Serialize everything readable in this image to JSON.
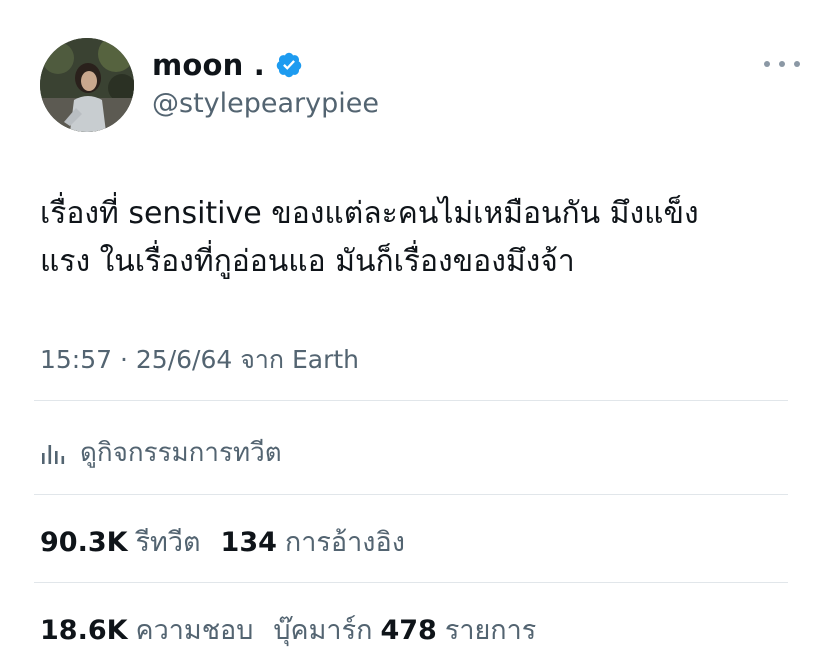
{
  "user": {
    "display_name": "moon .",
    "handle": "@stylepearypiee",
    "verified": true
  },
  "tweet": {
    "line1": "เรื่องที่ sensitive ของแต่ละคนไม่เหมือนกัน มึงแข็ง",
    "line2": "แรง ในเรื่องที่กูอ่อนแอ มันก็เรื่องของมึงจ้า",
    "meta": "15:57 · 25/6/64 จาก Earth"
  },
  "activity": {
    "label": "ดูกิจกรรมการทวีต"
  },
  "stats": {
    "retweets_count": "90.3K",
    "retweets_label": "รีทวีต",
    "quotes_count": "134",
    "quotes_label": "การอ้างอิง",
    "likes_count": "18.6K",
    "likes_label": "ความชอบ",
    "bookmarks_label": "บุ๊คมาร์ก",
    "bookmarks_count": "478",
    "bookmarks_suffix": "รายการ"
  },
  "colors": {
    "text_primary": "#0f1419",
    "text_secondary": "#536471",
    "verified_badge": "#1d9bf0",
    "divider": "#e1e6ea"
  },
  "icons": {
    "verified": "verified-badge-icon",
    "more": "more-options-icon",
    "activity": "bar-chart-icon"
  }
}
